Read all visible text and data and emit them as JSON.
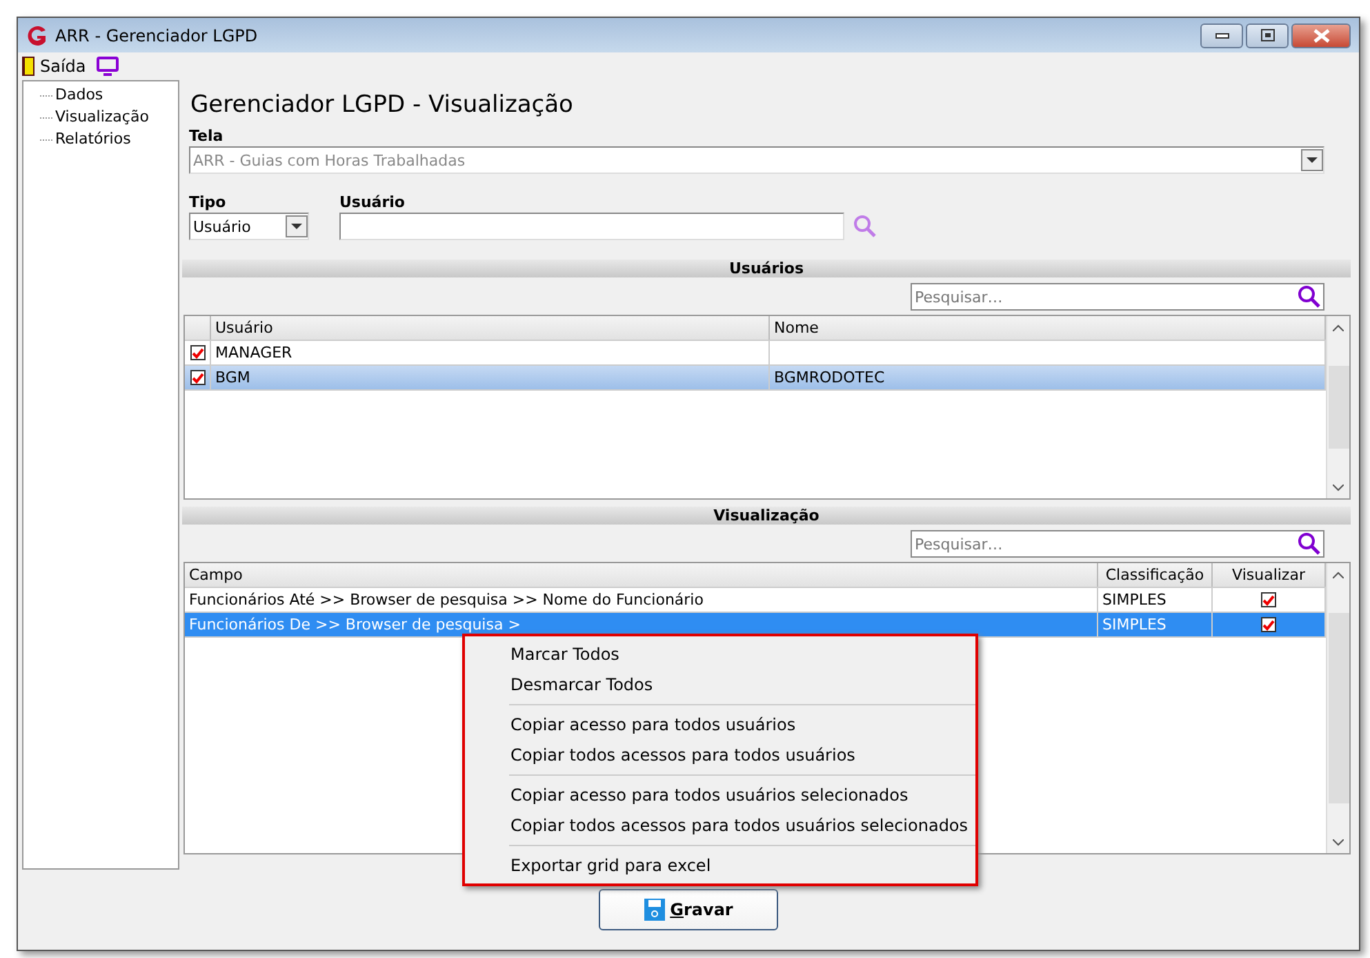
{
  "window": {
    "title": "ARR - Gerenciador LGPD"
  },
  "toolbar": {
    "exit_label": "Saída"
  },
  "sidebar": {
    "items": [
      {
        "label": "Dados"
      },
      {
        "label": "Visualização"
      },
      {
        "label": "Relatórios"
      }
    ]
  },
  "heading": "Gerenciador LGPD - Visualização",
  "tela": {
    "label": "Tela",
    "value": "ARR - Guias com Horas Trabalhadas",
    "disabled": true
  },
  "tipo": {
    "label": "Tipo",
    "value": "Usuário"
  },
  "usuario": {
    "label": "Usuário"
  },
  "users_section": {
    "title": "Usuários",
    "search_placeholder": "Pesquisar…",
    "columns": [
      "Usuário",
      "Nome"
    ],
    "rows": [
      {
        "checked": true,
        "usuario": "MANAGER",
        "nome": "",
        "selected": false
      },
      {
        "checked": true,
        "usuario": "BGM",
        "nome": "BGMRODOTEC",
        "selected": true
      }
    ]
  },
  "view_section": {
    "title": "Visualização",
    "search_placeholder": "Pesquisar…",
    "columns": [
      "Campo",
      "Classificação",
      "Visualizar"
    ],
    "rows": [
      {
        "campo": "Funcionários Até >> Browser de pesquisa >> Nome do Funcionário",
        "classificacao": "SIMPLES",
        "checked": true,
        "selected": false
      },
      {
        "campo": "Funcionários De >> Browser de pesquisa >",
        "classificacao": "SIMPLES",
        "checked": true,
        "selected": true
      }
    ]
  },
  "context_menu": {
    "groups": [
      [
        "Marcar Todos",
        "Desmarcar Todos"
      ],
      [
        "Copiar acesso para todos usuários",
        "Copiar todos acessos para todos usuários"
      ],
      [
        "Copiar acesso para todos usuários selecionados",
        "Copiar todos acessos para todos usuários selecionados"
      ],
      [
        "Exportar grid para excel"
      ]
    ]
  },
  "save_button": {
    "label": "Gravar"
  }
}
